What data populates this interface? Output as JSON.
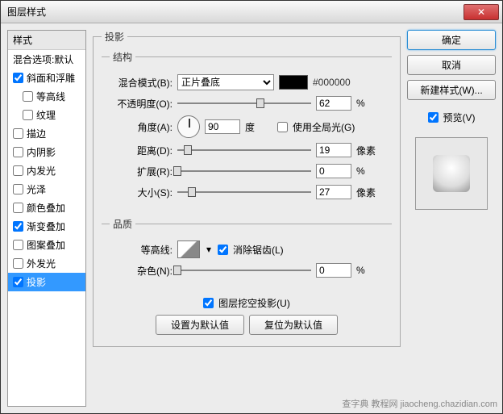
{
  "window": {
    "title": "图层样式",
    "close": "✕"
  },
  "sidebar": {
    "header": "样式",
    "blending": "混合选项:默认",
    "items": [
      {
        "label": "斜面和浮雕",
        "checked": true
      },
      {
        "label": "等高线",
        "checked": false,
        "indent": true
      },
      {
        "label": "纹理",
        "checked": false,
        "indent": true
      },
      {
        "label": "描边",
        "checked": false
      },
      {
        "label": "内阴影",
        "checked": false
      },
      {
        "label": "内发光",
        "checked": false
      },
      {
        "label": "光泽",
        "checked": false
      },
      {
        "label": "颜色叠加",
        "checked": false
      },
      {
        "label": "渐变叠加",
        "checked": true
      },
      {
        "label": "图案叠加",
        "checked": false
      },
      {
        "label": "外发光",
        "checked": false
      },
      {
        "label": "投影",
        "checked": true,
        "selected": true
      }
    ]
  },
  "main": {
    "panel_title": "投影",
    "structure": {
      "legend": "结构",
      "blend_mode_label": "混合模式(B):",
      "blend_mode_value": "正片叠底",
      "color_hex": "#000000",
      "opacity_label": "不透明度(O):",
      "opacity_value": "62",
      "opacity_unit": "%",
      "angle_label": "角度(A):",
      "angle_value": "90",
      "angle_unit": "度",
      "global_light_label": "使用全局光(G)",
      "distance_label": "距离(D):",
      "distance_value": "19",
      "distance_unit": "像素",
      "spread_label": "扩展(R):",
      "spread_value": "0",
      "spread_unit": "%",
      "size_label": "大小(S):",
      "size_value": "27",
      "size_unit": "像素"
    },
    "quality": {
      "legend": "品质",
      "contour_label": "等高线:",
      "antialias_label": "消除锯齿(L)",
      "noise_label": "杂色(N):",
      "noise_value": "0",
      "noise_unit": "%"
    },
    "knockout_label": "图层挖空投影(U)",
    "set_default": "设置为默认值",
    "reset_default": "复位为默认值"
  },
  "right": {
    "ok": "确定",
    "cancel": "取消",
    "new_style": "新建样式(W)...",
    "preview_label": "预览(V)"
  },
  "watermark": "查字典 教程网  jiaocheng.chazidian.com"
}
